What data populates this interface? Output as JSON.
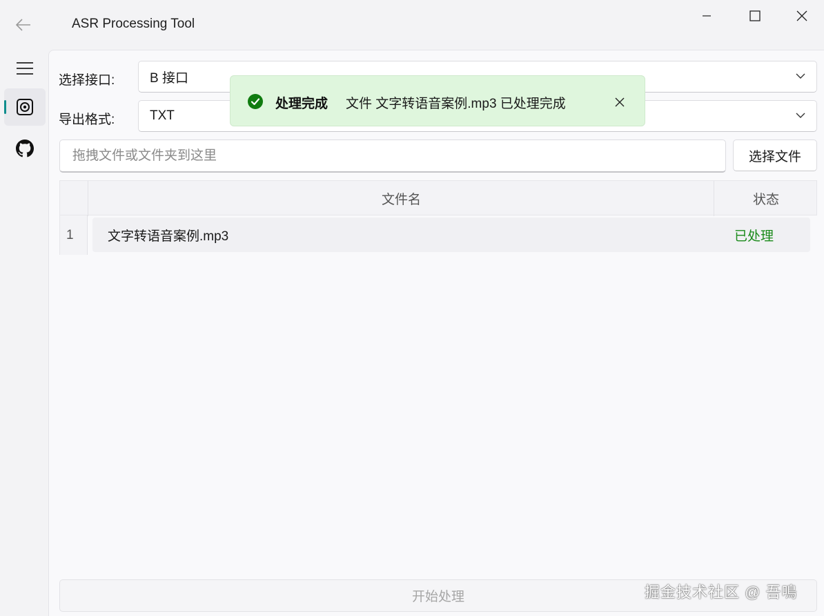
{
  "window": {
    "title": "ASR Processing Tool"
  },
  "form": {
    "interface_label": "选择接口:",
    "interface_value": "B 接口",
    "format_label": "导出格式:",
    "format_value": "TXT",
    "drop_placeholder": "拖拽文件或文件夹到这里",
    "choose_file_label": "选择文件"
  },
  "table": {
    "headers": [
      "文件名",
      "状态"
    ],
    "rows": [
      {
        "index": "1",
        "name": "文字转语音案例.mp3",
        "status": "已处理"
      }
    ]
  },
  "start_button": "开始处理",
  "toast": {
    "title": "处理完成",
    "message": "文件 文字转语音案例.mp3 已处理完成"
  },
  "watermark": "掘金技术社区 @ 吾鳴",
  "icons": {
    "back": "back-arrow-icon",
    "menu": "hamburger-menu-icon",
    "active_nav": "record-icon",
    "github": "github-icon",
    "success": "check-circle-icon"
  },
  "colors": {
    "accent": "#0f8d8d",
    "success": "#107c10",
    "toast_bg": "#dff6dd",
    "status_text": "#1a8a1a"
  }
}
